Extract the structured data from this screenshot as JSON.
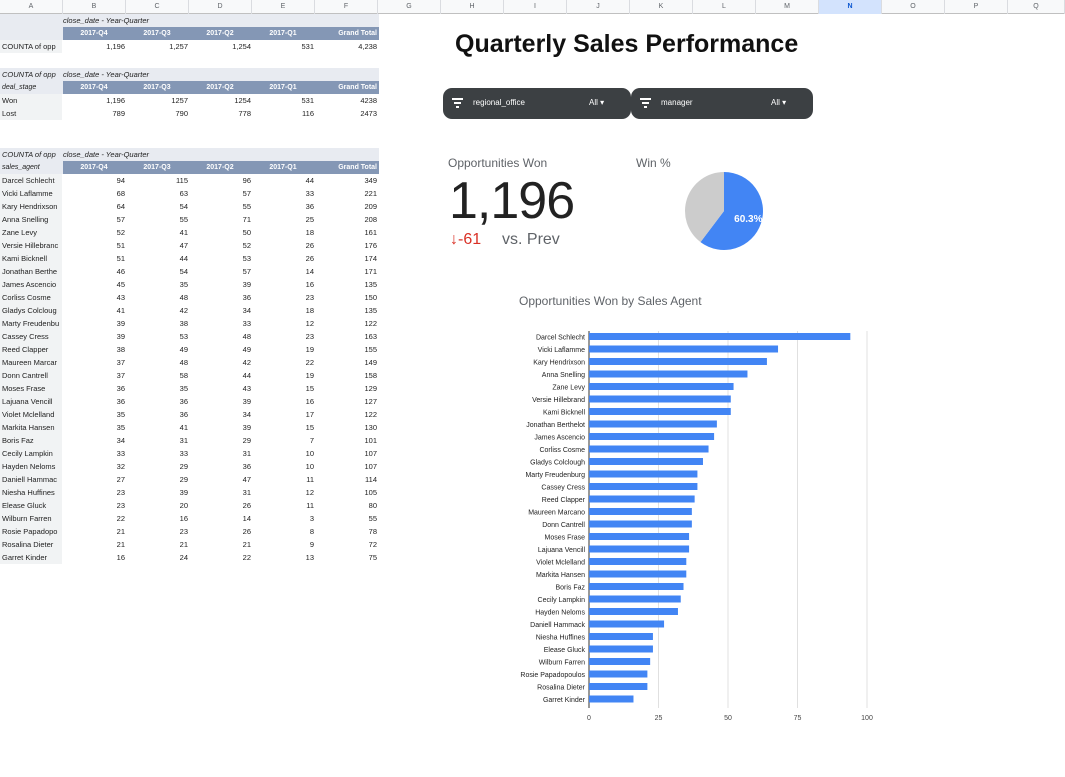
{
  "columns": [
    "A",
    "B",
    "C",
    "D",
    "E",
    "F",
    "G",
    "H",
    "I",
    "J",
    "K",
    "L",
    "M",
    "N",
    "O",
    "P",
    "Q"
  ],
  "selected_column": "N",
  "pivot1": {
    "top_label": "close_date - Year-Quarter",
    "headers": [
      "2017-Q4",
      "2017-Q3",
      "2017-Q2",
      "2017-Q1",
      "Grand Total"
    ],
    "rows": [
      {
        "label": "COUNTA of opp",
        "values": [
          "1,196",
          "1,257",
          "1,254",
          "531",
          "4,238"
        ]
      }
    ]
  },
  "pivot2": {
    "corner_label": "COUNTA of opp",
    "top_label": "close_date - Year-Quarter",
    "row_label": "deal_stage",
    "headers": [
      "2017-Q4",
      "2017-Q3",
      "2017-Q2",
      "2017-Q1",
      "Grand Total"
    ],
    "rows": [
      {
        "label": "Won",
        "values": [
          "1,196",
          "1257",
          "1254",
          "531",
          "4238"
        ]
      },
      {
        "label": "Lost",
        "values": [
          "789",
          "790",
          "778",
          "116",
          "2473"
        ]
      }
    ]
  },
  "pivot3": {
    "corner_label": "COUNTA of opp",
    "top_label": "close_date - Year-Quarter",
    "row_label": "sales_agent",
    "headers": [
      "2017-Q4",
      "2017-Q3",
      "2017-Q2",
      "2017-Q1",
      "Grand Total"
    ],
    "rows": [
      {
        "label": "Darcel Schlecht",
        "values": [
          "94",
          "115",
          "96",
          "44",
          "349"
        ]
      },
      {
        "label": "Vicki Laflamme",
        "values": [
          "68",
          "63",
          "57",
          "33",
          "221"
        ]
      },
      {
        "label": "Kary Hendrixson",
        "values": [
          "64",
          "54",
          "55",
          "36",
          "209"
        ]
      },
      {
        "label": "Anna Snelling",
        "values": [
          "57",
          "55",
          "71",
          "25",
          "208"
        ]
      },
      {
        "label": "Zane Levy",
        "values": [
          "52",
          "41",
          "50",
          "18",
          "161"
        ]
      },
      {
        "label": "Versie Hillebranc",
        "values": [
          "51",
          "47",
          "52",
          "26",
          "176"
        ]
      },
      {
        "label": "Kami Bicknell",
        "values": [
          "51",
          "44",
          "53",
          "26",
          "174"
        ]
      },
      {
        "label": "Jonathan Berthe",
        "values": [
          "46",
          "54",
          "57",
          "14",
          "171"
        ]
      },
      {
        "label": "James Ascencio",
        "values": [
          "45",
          "35",
          "39",
          "16",
          "135"
        ]
      },
      {
        "label": "Corliss Cosme",
        "values": [
          "43",
          "48",
          "36",
          "23",
          "150"
        ]
      },
      {
        "label": "Gladys Colcloug",
        "values": [
          "41",
          "42",
          "34",
          "18",
          "135"
        ]
      },
      {
        "label": "Marty Freudenbu",
        "values": [
          "39",
          "38",
          "33",
          "12",
          "122"
        ]
      },
      {
        "label": "Cassey Cress",
        "values": [
          "39",
          "53",
          "48",
          "23",
          "163"
        ]
      },
      {
        "label": "Reed Clapper",
        "values": [
          "38",
          "49",
          "49",
          "19",
          "155"
        ]
      },
      {
        "label": "Maureen Marcar",
        "values": [
          "37",
          "48",
          "42",
          "22",
          "149"
        ]
      },
      {
        "label": "Donn Cantrell",
        "values": [
          "37",
          "58",
          "44",
          "19",
          "158"
        ]
      },
      {
        "label": "Moses Frase",
        "values": [
          "36",
          "35",
          "43",
          "15",
          "129"
        ]
      },
      {
        "label": "Lajuana Vencill",
        "values": [
          "36",
          "36",
          "39",
          "16",
          "127"
        ]
      },
      {
        "label": "Violet Mclelland",
        "values": [
          "35",
          "36",
          "34",
          "17",
          "122"
        ]
      },
      {
        "label": "Markita Hansen",
        "values": [
          "35",
          "41",
          "39",
          "15",
          "130"
        ]
      },
      {
        "label": "Boris Faz",
        "values": [
          "34",
          "31",
          "29",
          "7",
          "101"
        ]
      },
      {
        "label": "Cecily Lampkin",
        "values": [
          "33",
          "33",
          "31",
          "10",
          "107"
        ]
      },
      {
        "label": "Hayden Neloms",
        "values": [
          "32",
          "29",
          "36",
          "10",
          "107"
        ]
      },
      {
        "label": "Daniell Hammac",
        "values": [
          "27",
          "29",
          "47",
          "11",
          "114"
        ]
      },
      {
        "label": "Niesha Huffines",
        "values": [
          "23",
          "39",
          "31",
          "12",
          "105"
        ]
      },
      {
        "label": "Elease Gluck",
        "values": [
          "23",
          "20",
          "26",
          "11",
          "80"
        ]
      },
      {
        "label": "Wilburn Farren",
        "values": [
          "22",
          "16",
          "14",
          "3",
          "55"
        ]
      },
      {
        "label": "Rosie Papadopo",
        "values": [
          "21",
          "23",
          "26",
          "8",
          "78"
        ]
      },
      {
        "label": "Rosalina Dieter",
        "values": [
          "21",
          "21",
          "21",
          "9",
          "72"
        ]
      },
      {
        "label": "Garret Kinder",
        "values": [
          "16",
          "24",
          "22",
          "13",
          "75"
        ]
      }
    ]
  },
  "dashboard": {
    "title": "Quarterly Sales Performance",
    "filters": [
      {
        "name": "regional_office",
        "value": "All ▾"
      },
      {
        "name": "manager",
        "value": "All ▾"
      }
    ],
    "scorecard": {
      "title": "Opportunities Won",
      "value": "1,196",
      "delta": "-61",
      "delta_label": "vs. Prev",
      "delta_color": "#d93025"
    },
    "pie_title": "Win %"
  },
  "chart_data": [
    {
      "type": "pie",
      "title": "Win %",
      "labels": [
        "Won",
        "Lost"
      ],
      "values": [
        60.3,
        39.7
      ],
      "slice_labels": [
        "60.3%",
        ""
      ],
      "colors": [
        "#4285f4",
        "#cccccc"
      ]
    },
    {
      "type": "bar",
      "orientation": "horizontal",
      "title": "Opportunities Won by Sales Agent",
      "categories": [
        "Darcel Schlecht",
        "Vicki Laflamme",
        "Kary Hendrixson",
        "Anna Snelling",
        "Zane Levy",
        "Versie Hillebrand",
        "Kami Bicknell",
        "Jonathan Berthelot",
        "James Ascencio",
        "Corliss Cosme",
        "Gladys Colclough",
        "Marty Freudenburg",
        "Cassey Cress",
        "Reed Clapper",
        "Maureen Marcano",
        "Donn Cantrell",
        "Moses Frase",
        "Lajuana Vencill",
        "Violet Mclelland",
        "Markita Hansen",
        "Boris Faz",
        "Cecily Lampkin",
        "Hayden Neloms",
        "Daniell Hammack",
        "Niesha Huffines",
        "Elease Gluck",
        "Wilburn Farren",
        "Rosie Papadopoulos",
        "Rosalina Dieter",
        "Garret Kinder"
      ],
      "values": [
        94,
        68,
        64,
        57,
        52,
        51,
        51,
        46,
        45,
        43,
        41,
        39,
        39,
        38,
        37,
        37,
        36,
        36,
        35,
        35,
        34,
        33,
        32,
        27,
        23,
        23,
        22,
        21,
        21,
        16
      ],
      "xlim": [
        0,
        100
      ],
      "xticks": [
        0,
        25,
        50,
        75,
        100
      ],
      "grid": true,
      "color": "#4285f4"
    }
  ]
}
